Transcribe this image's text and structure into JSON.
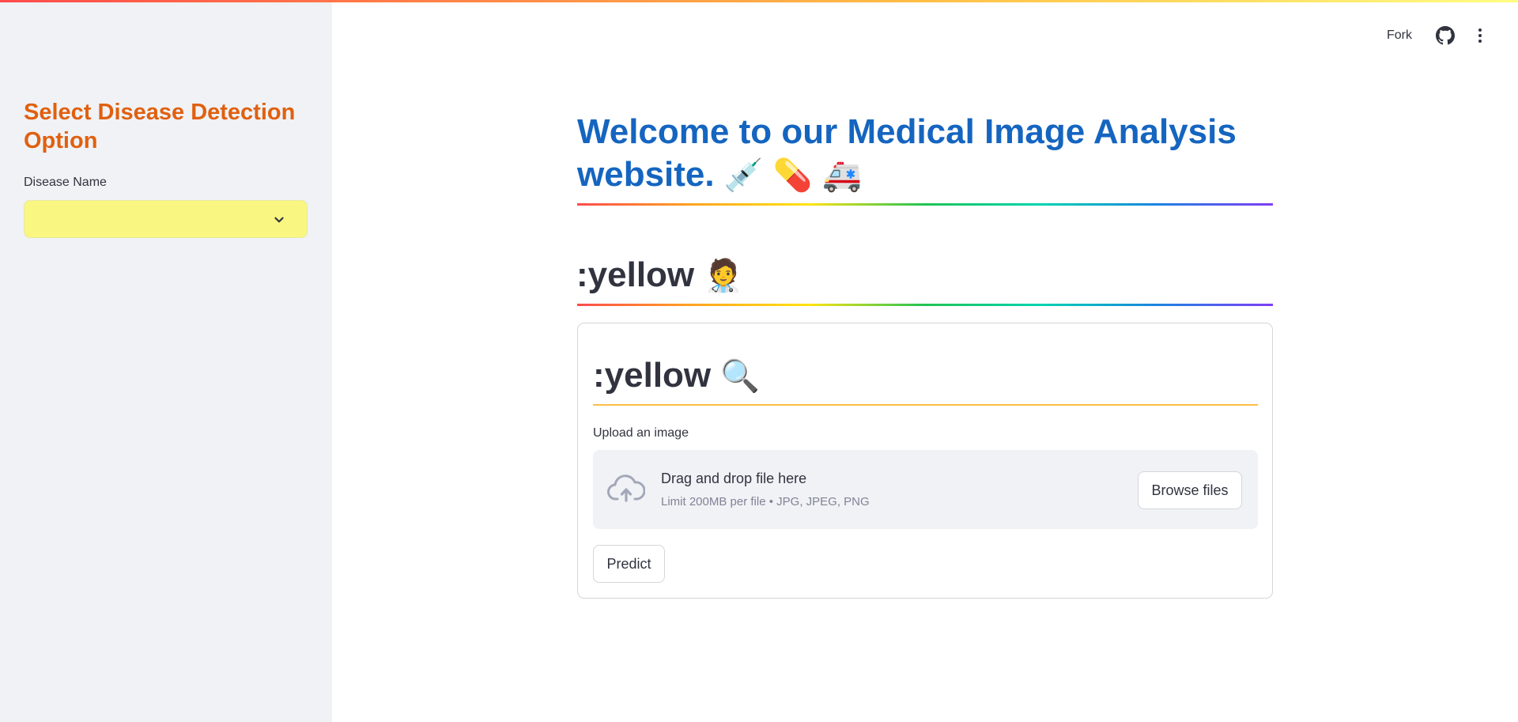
{
  "sidebar": {
    "title": "Select Disease Detection Option",
    "select_label": "Disease Name",
    "select_value": ""
  },
  "header": {
    "fork_label": "Fork",
    "github_icon": "github-icon",
    "menu_icon": "kebab-menu-icon"
  },
  "main": {
    "title": "Welcome to our Medical Image Analysis website.",
    "title_emojis": [
      "💉",
      "💊",
      "🚑"
    ],
    "subheader": ":yellow",
    "subheader_emoji": "🧑‍⚕️",
    "card": {
      "header": ":yellow",
      "header_emoji": "🔍",
      "upload_label": "Upload an image",
      "drop_text": "Drag and drop file here",
      "drop_limit": "Limit 200MB per file • JPG, JPEG, PNG",
      "browse_label": "Browse files",
      "predict_label": "Predict"
    }
  },
  "colors": {
    "accent": "#ff4b4b",
    "title_blue": "#1565c0",
    "sidebar_title": "#e0600f",
    "select_bg": "#f9f781",
    "card_divider": "#ffbd45"
  }
}
